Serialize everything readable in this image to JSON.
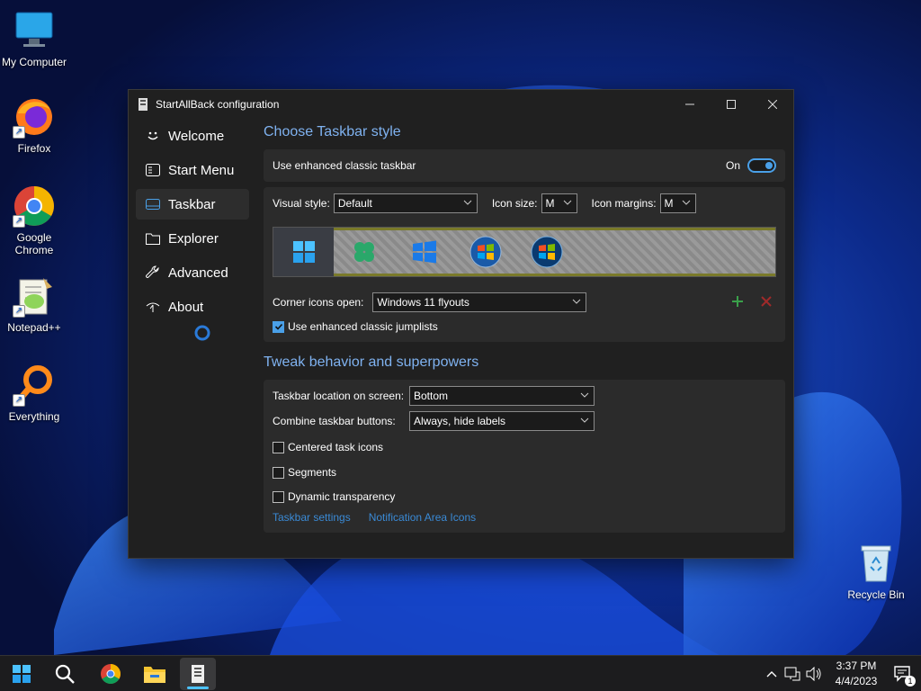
{
  "desktop": {
    "icons": [
      {
        "label": "My Computer",
        "icon": "monitor-icon"
      },
      {
        "label": "Firefox",
        "icon": "firefox-icon"
      },
      {
        "label": "Google Chrome",
        "icon": "chrome-icon"
      },
      {
        "label": "Notepad++",
        "icon": "notepad-plus-plus-icon"
      },
      {
        "label": "Everything",
        "icon": "everything-search-icon"
      },
      {
        "label": "Recycle Bin",
        "icon": "recycle-bin-icon"
      }
    ]
  },
  "window": {
    "title": "StartAllBack configuration",
    "sidebar": [
      {
        "label": "Welcome",
        "icon": "smiley-icon"
      },
      {
        "label": "Start Menu",
        "icon": "start-menu-icon"
      },
      {
        "label": "Taskbar",
        "icon": "taskbar-icon",
        "active": true
      },
      {
        "label": "Explorer",
        "icon": "explorer-icon"
      },
      {
        "label": "Advanced",
        "icon": "wrench-icon"
      },
      {
        "label": "About",
        "icon": "about-icon"
      }
    ],
    "section1": {
      "title": "Choose Taskbar style",
      "enhanced_label": "Use enhanced classic taskbar",
      "toggle_state": "On",
      "visual_style_label": "Visual style:",
      "visual_style_value": "Default",
      "icon_size_label": "Icon size:",
      "icon_size_value": "M",
      "icon_margins_label": "Icon margins:",
      "icon_margins_value": "M",
      "corner_icons_label": "Corner icons open:",
      "corner_icons_value": "Windows 11 flyouts",
      "jumplists_label": "Use enhanced classic jumplists",
      "jumplists_checked": true
    },
    "section2": {
      "title": "Tweak behavior and superpowers",
      "location_label": "Taskbar location on screen:",
      "location_value": "Bottom",
      "combine_label": "Combine taskbar buttons:",
      "combine_value": "Always, hide labels",
      "centered_label": "Centered task icons",
      "segments_label": "Segments",
      "dynamic_label": "Dynamic transparency",
      "link_taskbar_settings": "Taskbar settings",
      "link_notification_icons": "Notification Area Icons"
    }
  },
  "taskbar": {
    "time": "3:37 PM",
    "date": "4/4/2023",
    "notification_count": "1"
  },
  "colors": {
    "accent": "#4aa0e8",
    "section_title": "#7fb2f0",
    "link": "#3a8ad6"
  }
}
